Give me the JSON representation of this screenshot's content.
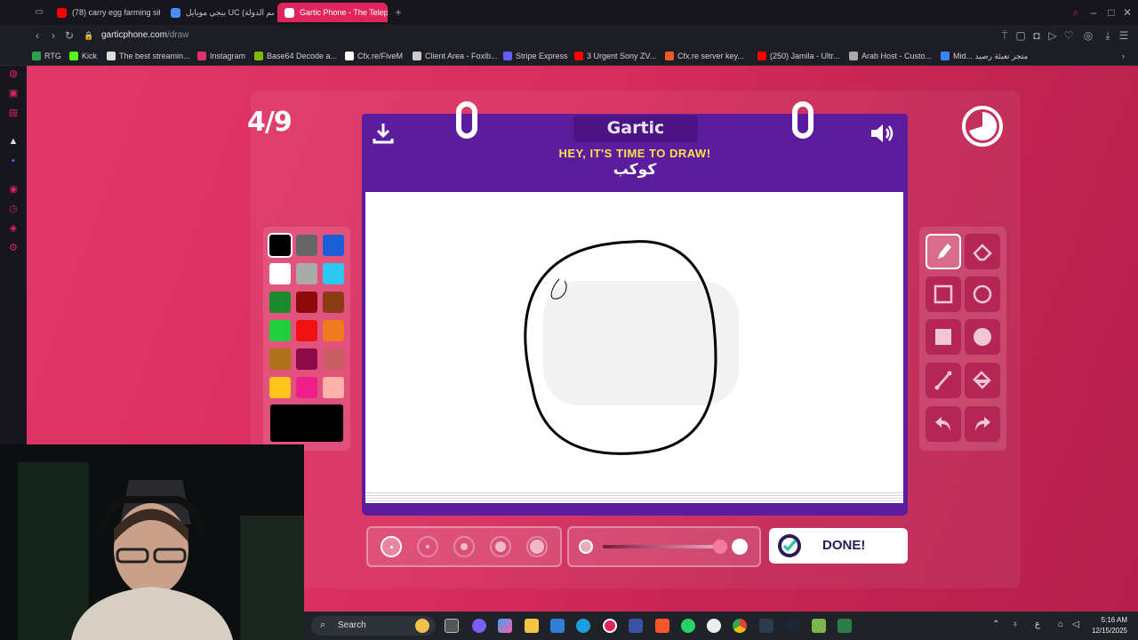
{
  "browser": {
    "tabs": [
      {
        "label": "(78) carry egg farming sit",
        "favicon_color": "#ff0000"
      },
      {
        "label": "ببجي موبايل UC (اسم الدولة)",
        "favicon_color": "#4a8cff"
      },
      {
        "label": "Gartic Phone - The Teleph",
        "favicon_color": "#ffffff",
        "active": true
      }
    ],
    "url_domain": "garticphone.com",
    "url_path": "/draw",
    "bookmarks": [
      {
        "label": "RTG",
        "color": "#2ca24b"
      },
      {
        "label": "Kick",
        "color": "#53fc18"
      },
      {
        "label": "The best streamin...",
        "color": "#dddddd"
      },
      {
        "label": "Instagram",
        "color": "#e1306c"
      },
      {
        "label": "Base64 Decode a...",
        "color": "#7cbb00"
      },
      {
        "label": "Cfx.re/FiveM",
        "color": "#ffffff"
      },
      {
        "label": "Client Area - Foxib...",
        "color": "#cccccc"
      },
      {
        "label": "Stripe Express",
        "color": "#635bff"
      },
      {
        "label": "3 Urgent Sony ZV...",
        "color": "#ff0000"
      },
      {
        "label": "Cfx.re server key...",
        "color": "#f05a28"
      },
      {
        "label": "(250) Jamila - Ultr...",
        "color": "#ff0000"
      },
      {
        "label": "Arab Host - Custo...",
        "color": "#aaaaaa"
      },
      {
        "label": "Mid... متجر تعبئة رصيد",
        "color": "#3b82f6"
      }
    ]
  },
  "game": {
    "round": "4/9",
    "logo": "Gartic",
    "prompt_title": "HEY, IT'S TIME TO DRAW!",
    "prompt_word": "كوكب",
    "done_label": "DONE!",
    "colors": [
      "#000000",
      "#666666",
      "#1b5fd8",
      "#ffffff",
      "#aaaaaa",
      "#2ec7f2",
      "#1a8a2d",
      "#8e0b0b",
      "#8c3b14",
      "#1fcf3b",
      "#ef1313",
      "#ef7a22",
      "#b07219",
      "#8c0a4a",
      "#cc5d64",
      "#ffc51d",
      "#ef1f8a",
      "#fdb1a8"
    ],
    "selected_color": "#000000",
    "brush_sizes": [
      1,
      2,
      3,
      4,
      5
    ],
    "selected_brush_size": 1,
    "opacity_level": 1.0,
    "tools": [
      {
        "name": "pen-tool",
        "active": true
      },
      {
        "name": "eraser-tool"
      },
      {
        "name": "rectangle-outline-tool"
      },
      {
        "name": "ellipse-outline-tool"
      },
      {
        "name": "rectangle-fill-tool"
      },
      {
        "name": "ellipse-fill-tool"
      },
      {
        "name": "line-tool"
      },
      {
        "name": "fill-bucket-tool"
      },
      {
        "name": "undo-tool"
      },
      {
        "name": "redo-tool"
      }
    ]
  },
  "taskbar": {
    "search_label": "Search",
    "time": "5:16 AM",
    "date": "12/15/2025",
    "lang": "ع"
  }
}
